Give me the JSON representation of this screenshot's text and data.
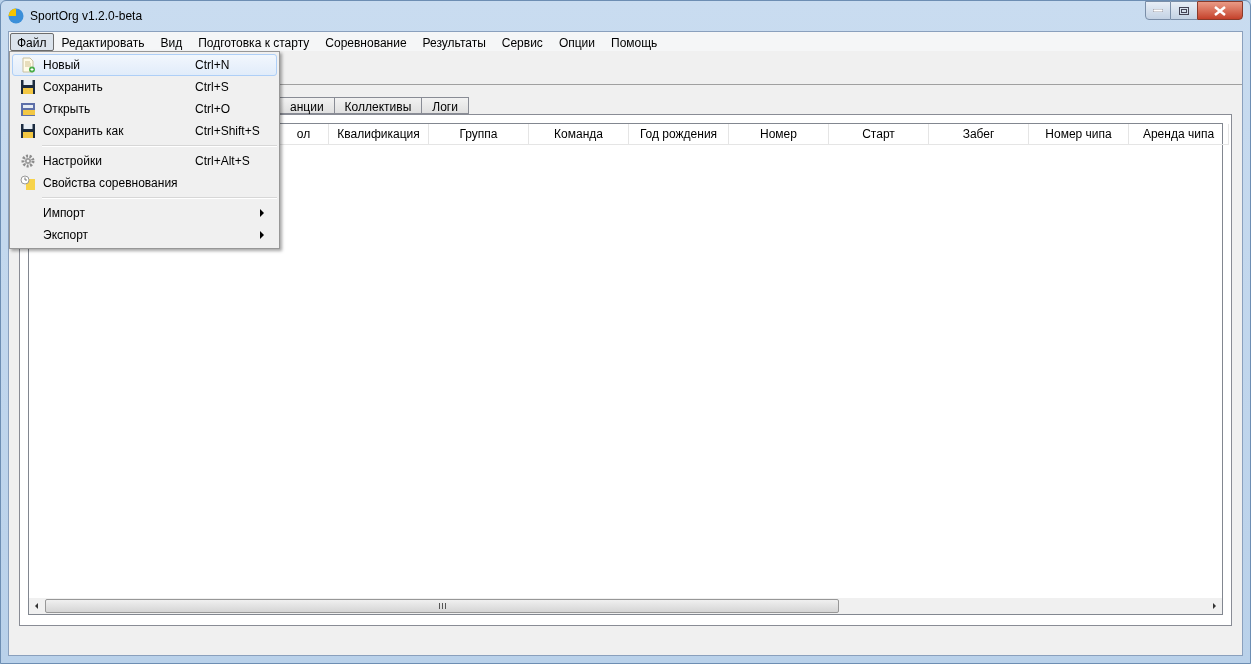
{
  "window": {
    "title": "SportOrg v1.2.0-beta"
  },
  "menu_bar": [
    {
      "label": "Файл",
      "selected": true
    },
    {
      "label": "Редактировать",
      "selected": false
    },
    {
      "label": "Вид",
      "selected": false
    },
    {
      "label": "Подготовка к старту",
      "selected": false
    },
    {
      "label": "Соревнование",
      "selected": false
    },
    {
      "label": "Результаты",
      "selected": false
    },
    {
      "label": "Сервис",
      "selected": false
    },
    {
      "label": "Опции",
      "selected": false
    },
    {
      "label": "Помощь",
      "selected": false
    }
  ],
  "file_menu": [
    {
      "kind": "item",
      "label": "Новый",
      "shortcut": "Ctrl+N",
      "selected": true
    },
    {
      "kind": "item",
      "label": "Сохранить",
      "shortcut": "Ctrl+S",
      "selected": false
    },
    {
      "kind": "item",
      "label": "Открыть",
      "shortcut": "Ctrl+O",
      "selected": false
    },
    {
      "kind": "item",
      "label": "Сохранить как",
      "shortcut": "Ctrl+Shift+S",
      "selected": false
    },
    {
      "kind": "separator"
    },
    {
      "kind": "item",
      "label": "Настройки",
      "shortcut": "Ctrl+Alt+S",
      "selected": false
    },
    {
      "kind": "item",
      "label": "Свойства соревнования",
      "selected": false
    },
    {
      "kind": "separator"
    },
    {
      "kind": "submenu",
      "label": "Импорт",
      "selected": false
    },
    {
      "kind": "submenu",
      "label": "Экспорт",
      "selected": false
    }
  ],
  "tabs": [
    {
      "label": "анции",
      "selected": false
    },
    {
      "label": "Коллективы",
      "selected": false
    },
    {
      "label": "Логи",
      "selected": false
    }
  ],
  "table": {
    "columns": [
      "ол",
      "Квалификация",
      "Группа",
      "Команда",
      "Год рождения",
      "Номер",
      "Старт",
      "Забег",
      "Номер чипа",
      "Аренда чипа"
    ]
  }
}
